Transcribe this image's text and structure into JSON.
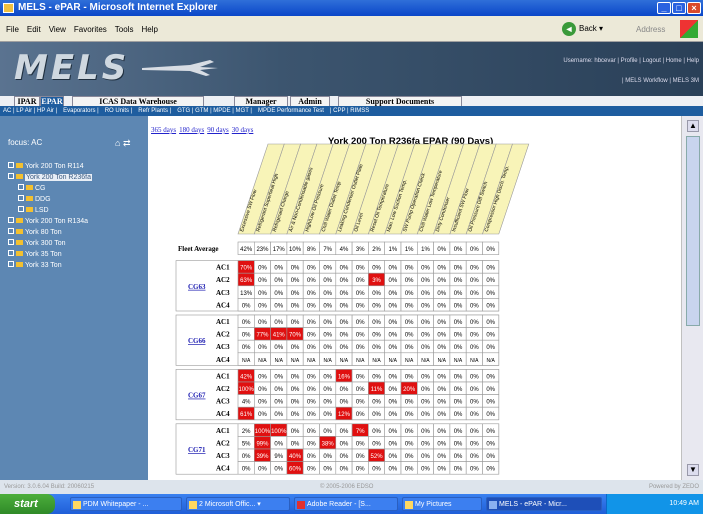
{
  "window": {
    "title": "MELS - ePAR - Microsoft Internet Explorer"
  },
  "ie": {
    "menu": [
      "File",
      "Edit",
      "View",
      "Favorites",
      "Tools",
      "Help"
    ],
    "back": "Back",
    "address": "Address"
  },
  "banner": {
    "logo": "MELS",
    "user_links": "Username: hbcevar | Profile | Logout | Home | Help",
    "user_links2": "| MELS Workflow | MELS 3M"
  },
  "tabs": [
    {
      "label": "IPAR"
    },
    {
      "label": "EPAR"
    },
    {
      "label": "ICAS Data Warehouse"
    },
    {
      "label": "Manager"
    },
    {
      "label": "Admin"
    },
    {
      "label": "Support Documents"
    }
  ],
  "subnav": [
    "AC | LP Air | HP Air |",
    "Evaporators |",
    "RO Units |",
    "Refr Plants |",
    "GTG | GTM | MPDE | MGT |",
    "MPDE Performance Test",
    "| CPP | RIMSS"
  ],
  "sidebar": {
    "focus": "focus: AC",
    "tree": [
      {
        "label": "York 200 Ton R114",
        "level": 0
      },
      {
        "label": "York 200 Ton R236fa",
        "level": 0,
        "selected": true
      },
      {
        "label": "CG",
        "level": 1
      },
      {
        "label": "DDG",
        "level": 1
      },
      {
        "label": "LSD",
        "level": 1
      },
      {
        "label": "York 200 Ton R134a",
        "level": 0
      },
      {
        "label": "York 80 Ton",
        "level": 0
      },
      {
        "label": "York 300 Ton",
        "level": 0
      },
      {
        "label": "York 35 Ton",
        "level": 0
      },
      {
        "label": "York 33 Ton",
        "level": 0
      }
    ]
  },
  "main": {
    "days": [
      "365 days",
      "180 days",
      "90 days",
      "30 days"
    ],
    "title": "York 200 Ton R236fa EPAR (90 Days)"
  },
  "grid": {
    "columns": [
      "Excessive SW Flow",
      "Refrigerant Superheat High",
      "Refrigerant Charge",
      "Air & Non-Condensable gases",
      "High/Low Oil Pressure",
      "Chill Water Outlet Temp",
      "Leaking Condenser Outlet Plate",
      "Oil Level",
      "Reset Oil Temperature",
      "Man. Low Suction Temp.",
      "SW Pump Operation Check",
      "Chill Water Low Temperature",
      "Dirty Condenser",
      "Insufficient SW Flow",
      "Oil Pressure Diff Switch",
      "Compressor High Disch. Temp."
    ],
    "fleet_label": "Fleet Average",
    "fleet": [
      "42%",
      "23%",
      "17%",
      "10%",
      "8%",
      "7%",
      "4%",
      "3%",
      "2%",
      "1%",
      "1%",
      "1%",
      "0%",
      "0%",
      "0%",
      "0%"
    ],
    "groups": [
      {
        "ship": "CG63",
        "rows": [
          {
            "ac": "AC1",
            "v": [
              "70%",
              "0%",
              "0%",
              "0%",
              "0%",
              "0%",
              "0%",
              "0%",
              "0%",
              "0%",
              "0%",
              "0%",
              "0%",
              "0%",
              "0%",
              "0%"
            ]
          },
          {
            "ac": "AC2",
            "v": [
              "63%",
              "0%",
              "0%",
              "0%",
              "0%",
              "0%",
              "0%",
              "0%",
              "3%",
              "0%",
              "0%",
              "0%",
              "0%",
              "0%",
              "0%",
              "0%"
            ]
          },
          {
            "ac": "AC3",
            "v": [
              "13%",
              "0%",
              "0%",
              "0%",
              "0%",
              "0%",
              "0%",
              "0%",
              "0%",
              "0%",
              "0%",
              "0%",
              "0%",
              "0%",
              "0%",
              "0%"
            ]
          },
          {
            "ac": "AC4",
            "v": [
              "0%",
              "0%",
              "0%",
              "0%",
              "0%",
              "0%",
              "0%",
              "0%",
              "0%",
              "0%",
              "0%",
              "0%",
              "0%",
              "0%",
              "0%",
              "0%"
            ]
          }
        ]
      },
      {
        "ship": "CG66",
        "rows": [
          {
            "ac": "AC1",
            "v": [
              "0%",
              "0%",
              "0%",
              "0%",
              "0%",
              "0%",
              "0%",
              "0%",
              "0%",
              "0%",
              "0%",
              "0%",
              "0%",
              "0%",
              "0%",
              "0%"
            ]
          },
          {
            "ac": "AC2",
            "v": [
              "0%",
              "77%",
              "41%",
              "70%",
              "0%",
              "0%",
              "0%",
              "0%",
              "0%",
              "0%",
              "0%",
              "0%",
              "0%",
              "0%",
              "0%",
              "0%"
            ]
          },
          {
            "ac": "AC3",
            "v": [
              "0%",
              "0%",
              "0%",
              "0%",
              "0%",
              "0%",
              "0%",
              "0%",
              "0%",
              "0%",
              "0%",
              "0%",
              "0%",
              "0%",
              "0%",
              "0%"
            ]
          },
          {
            "ac": "AC4",
            "v": [
              "N/A",
              "N/A",
              "N/A",
              "N/A",
              "N/A",
              "N/A",
              "N/A",
              "N/A",
              "N/A",
              "N/A",
              "N/A",
              "N/A",
              "N/A",
              "N/A",
              "N/A",
              "N/A"
            ]
          }
        ]
      },
      {
        "ship": "CG67",
        "rows": [
          {
            "ac": "AC1",
            "v": [
              "42%",
              "0%",
              "0%",
              "0%",
              "0%",
              "0%",
              "16%",
              "0%",
              "0%",
              "0%",
              "0%",
              "0%",
              "0%",
              "0%",
              "0%",
              "0%"
            ]
          },
          {
            "ac": "AC2",
            "v": [
              "100%",
              "0%",
              "0%",
              "0%",
              "0%",
              "0%",
              "0%",
              "0%",
              "11%",
              "0%",
              "20%",
              "0%",
              "0%",
              "0%",
              "0%",
              "0%"
            ]
          },
          {
            "ac": "AC3",
            "v": [
              "4%",
              "0%",
              "0%",
              "0%",
              "0%",
              "0%",
              "0%",
              "0%",
              "0%",
              "0%",
              "0%",
              "0%",
              "0%",
              "0%",
              "0%",
              "0%"
            ]
          },
          {
            "ac": "AC4",
            "v": [
              "61%",
              "0%",
              "0%",
              "0%",
              "0%",
              "0%",
              "12%",
              "0%",
              "0%",
              "0%",
              "0%",
              "0%",
              "0%",
              "0%",
              "0%",
              "0%"
            ]
          }
        ]
      },
      {
        "ship": "CG71",
        "rows": [
          {
            "ac": "AC1",
            "v": [
              "2%",
              "100%",
              "100%",
              "0%",
              "0%",
              "0%",
              "0%",
              "7%",
              "0%",
              "0%",
              "0%",
              "0%",
              "0%",
              "0%",
              "0%",
              "0%"
            ]
          },
          {
            "ac": "AC2",
            "v": [
              "5%",
              "99%",
              "0%",
              "0%",
              "0%",
              "38%",
              "0%",
              "0%",
              "0%",
              "0%",
              "0%",
              "0%",
              "0%",
              "0%",
              "0%",
              "0%"
            ]
          },
          {
            "ac": "AC3",
            "v": [
              "0%",
              "39%",
              "9%",
              "40%",
              "0%",
              "0%",
              "0%",
              "0%",
              "52%",
              "0%",
              "0%",
              "0%",
              "0%",
              "0%",
              "0%",
              "0%"
            ]
          },
          {
            "ac": "AC4",
            "v": [
              "0%",
              "0%",
              "0%",
              "60%",
              "0%",
              "0%",
              "0%",
              "0%",
              "0%",
              "0%",
              "0%",
              "0%",
              "0%",
              "0%",
              "0%",
              "0%"
            ]
          }
        ]
      }
    ],
    "highlights": [
      [
        0,
        0,
        0
      ],
      [
        0,
        1,
        0
      ],
      [
        0,
        1,
        8
      ],
      [
        1,
        1,
        1
      ],
      [
        1,
        1,
        2
      ],
      [
        1,
        1,
        3
      ],
      [
        2,
        0,
        0
      ],
      [
        2,
        0,
        6
      ],
      [
        2,
        1,
        0
      ],
      [
        2,
        1,
        8
      ],
      [
        2,
        1,
        10
      ],
      [
        2,
        3,
        0
      ],
      [
        2,
        3,
        6
      ],
      [
        3,
        0,
        1
      ],
      [
        3,
        0,
        2
      ],
      [
        3,
        0,
        7
      ],
      [
        3,
        1,
        1
      ],
      [
        3,
        1,
        5
      ],
      [
        3,
        2,
        1
      ],
      [
        3,
        2,
        3
      ],
      [
        3,
        2,
        8
      ],
      [
        3,
        3,
        3
      ]
    ],
    "colors": {
      "highlight": "#e01010",
      "header_bg": "#f8f4b8",
      "border": "#9a9a9a"
    }
  },
  "status": {
    "version": "Version: 3.0.6.04 Build: 20060215",
    "copyright": "© 2005-2006 EDSO",
    "powered": "Powered by ZEDO"
  },
  "taskbar": {
    "start": "start",
    "tasks": [
      "PDM Whitepaper - ...",
      "2 Microsoft Offic...",
      "Adobe Reader - [S...",
      "My Pictures",
      "MELS - ePAR - Micr..."
    ],
    "clock": "10:49 AM"
  }
}
